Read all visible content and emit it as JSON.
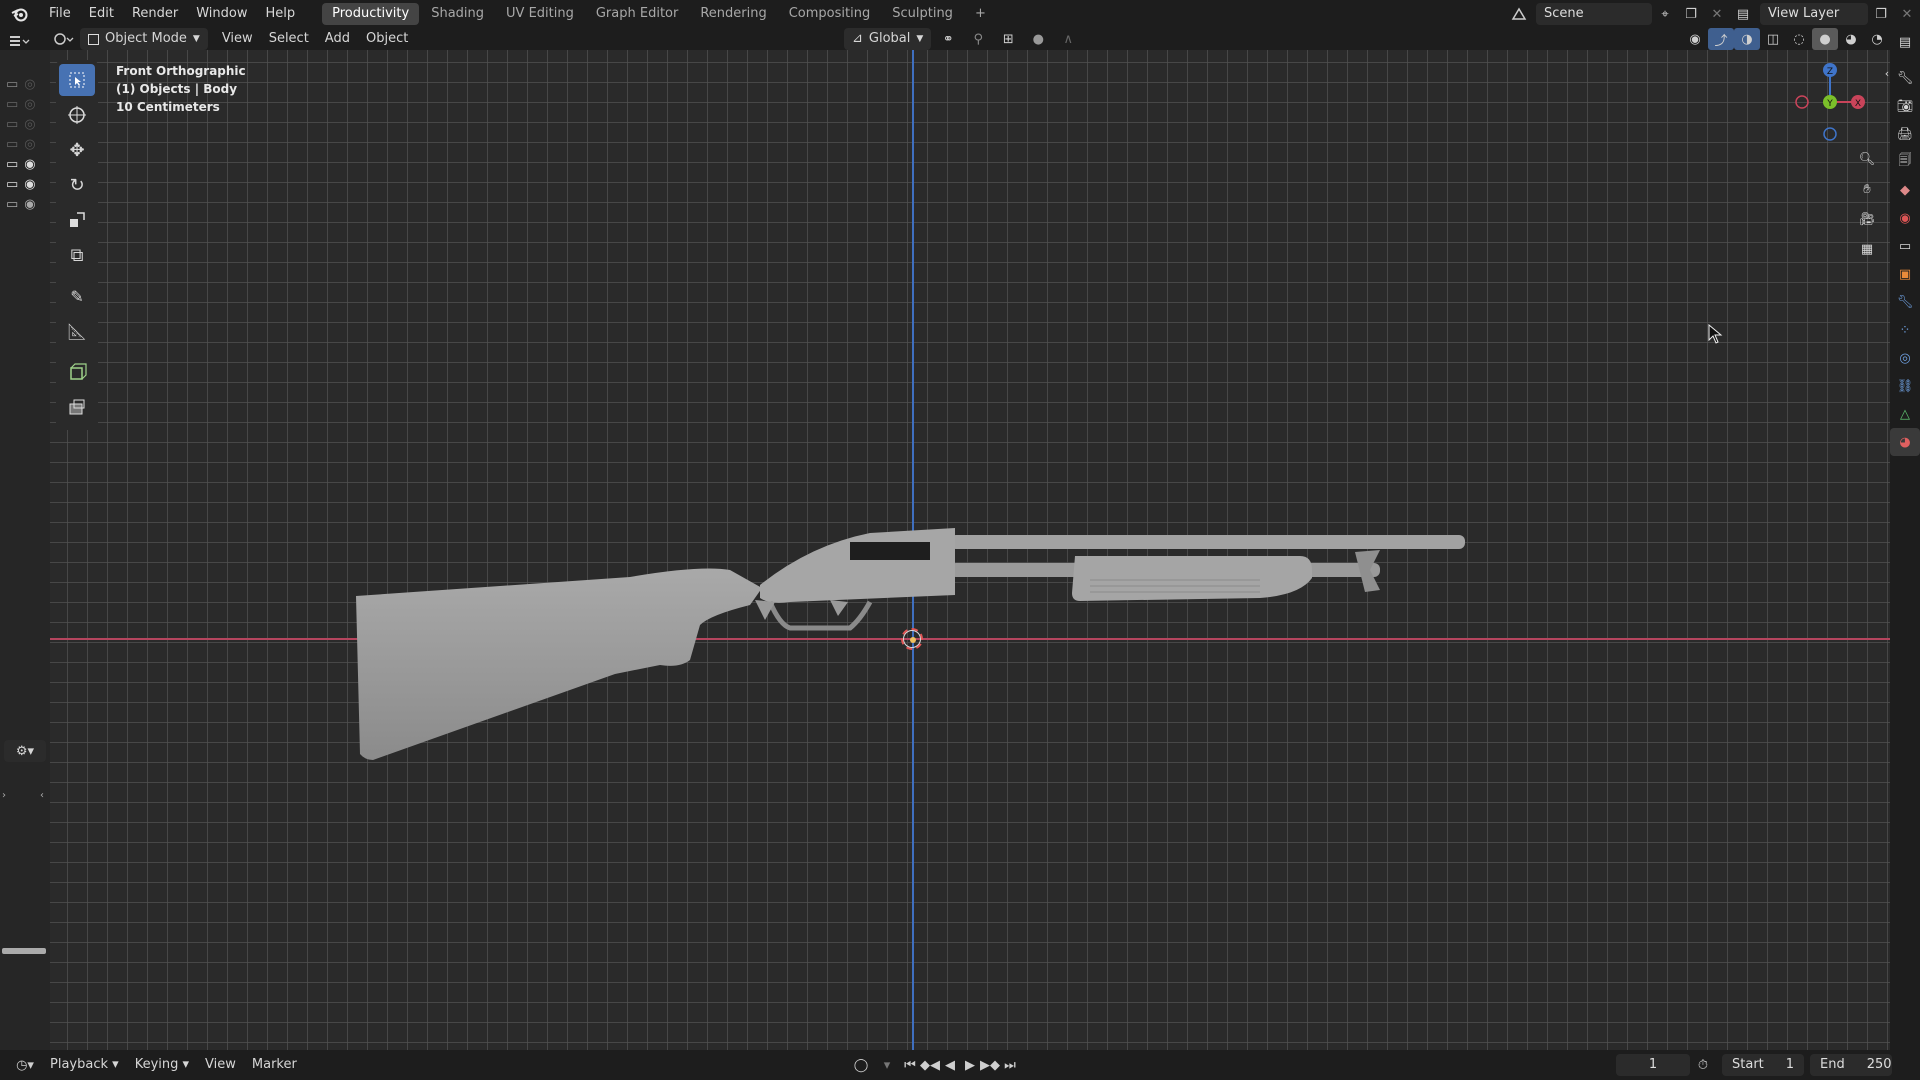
{
  "menus": [
    "File",
    "Edit",
    "Render",
    "Window",
    "Help"
  ],
  "workspaces": [
    "Productivity",
    "Shading",
    "UV Editing",
    "Graph Editor",
    "Rendering",
    "Compositing",
    "Sculpting"
  ],
  "active_workspace": "Productivity",
  "add_workspace": "+",
  "scene": {
    "name": "Scene"
  },
  "view_layer": {
    "name": "View Layer"
  },
  "header": {
    "mode": "Object Mode",
    "view": "View",
    "select": "Select",
    "add": "Add",
    "object": "Object",
    "orientation": "Global"
  },
  "overlay_info": {
    "view_name": "Front Orthographic",
    "collection": "(1) Objects | Body",
    "scale": "10 Centimeters"
  },
  "gizmo": {
    "z": "Z",
    "y": "Y",
    "x": "X"
  },
  "timeline": {
    "playback": "Playback",
    "keying": "Keying",
    "view": "View",
    "marker": "Marker",
    "current_frame": "1",
    "start_label": "Start",
    "start_value": "1",
    "end_label": "End",
    "end_value": "250"
  },
  "colors": {
    "accent": "#4772b3",
    "x_axis": "#c9445a",
    "z_axis": "#3f74c9",
    "y_axis": "#7bbf2a"
  },
  "icons": [
    "blender-logo",
    "select-box-icon",
    "cursor-icon",
    "move-icon",
    "rotate-icon",
    "scale-icon",
    "transform-icon",
    "annotate-icon",
    "measure-icon",
    "add-cube-icon",
    "extrude-icon",
    "zoom-icon",
    "hand-pan-icon",
    "camera-icon",
    "grid-icon"
  ]
}
